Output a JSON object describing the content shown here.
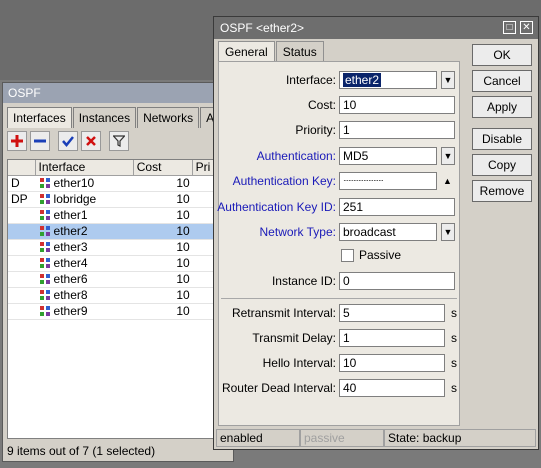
{
  "list_window": {
    "title": "OSPF",
    "tabs": [
      "Interfaces",
      "Instances",
      "Networks",
      "Areas"
    ],
    "columns": [
      "",
      "Interface",
      "Cost",
      "Pri"
    ],
    "rows": [
      {
        "flag": "D",
        "name": "ether10",
        "cost": "10",
        "selected": false
      },
      {
        "flag": "DP",
        "name": "lobridge",
        "cost": "10",
        "selected": false
      },
      {
        "flag": "",
        "name": "ether1",
        "cost": "10",
        "selected": false
      },
      {
        "flag": "",
        "name": "ether2",
        "cost": "10",
        "selected": true
      },
      {
        "flag": "",
        "name": "ether3",
        "cost": "10",
        "selected": false
      },
      {
        "flag": "",
        "name": "ether4",
        "cost": "10",
        "selected": false
      },
      {
        "flag": "",
        "name": "ether6",
        "cost": "10",
        "selected": false
      },
      {
        "flag": "",
        "name": "ether8",
        "cost": "10",
        "selected": false
      },
      {
        "flag": "",
        "name": "ether9",
        "cost": "10",
        "selected": false
      }
    ],
    "status": "9 items out of 7 (1 selected)"
  },
  "dialog": {
    "title": "OSPF <ether2>",
    "tabs": [
      "General",
      "Status"
    ],
    "fields": {
      "interface": {
        "label": "Interface:",
        "value": "ether2"
      },
      "cost": {
        "label": "Cost:",
        "value": "10"
      },
      "priority": {
        "label": "Priority:",
        "value": "1"
      },
      "authentication": {
        "label": "Authentication:",
        "value": "MD5"
      },
      "auth_key": {
        "label": "Authentication Key:",
        "value": "························"
      },
      "auth_key_id": {
        "label": "Authentication Key ID:",
        "value": "251"
      },
      "network_type": {
        "label": "Network Type:",
        "value": "broadcast"
      },
      "passive": {
        "label": "Passive",
        "checked": false
      },
      "instance_id": {
        "label": "Instance ID:",
        "value": "0"
      },
      "retransmit": {
        "label": "Retransmit Interval:",
        "value": "5",
        "unit": "s"
      },
      "transmit_delay": {
        "label": "Transmit Delay:",
        "value": "1",
        "unit": "s"
      },
      "hello": {
        "label": "Hello Interval:",
        "value": "10",
        "unit": "s"
      },
      "dead": {
        "label": "Router Dead Interval:",
        "value": "40",
        "unit": "s"
      }
    },
    "buttons": {
      "ok": "OK",
      "cancel": "Cancel",
      "apply": "Apply",
      "disable": "Disable",
      "copy": "Copy",
      "remove": "Remove"
    },
    "status": {
      "enabled": "enabled",
      "passive": "passive",
      "state": "State: backup"
    }
  }
}
